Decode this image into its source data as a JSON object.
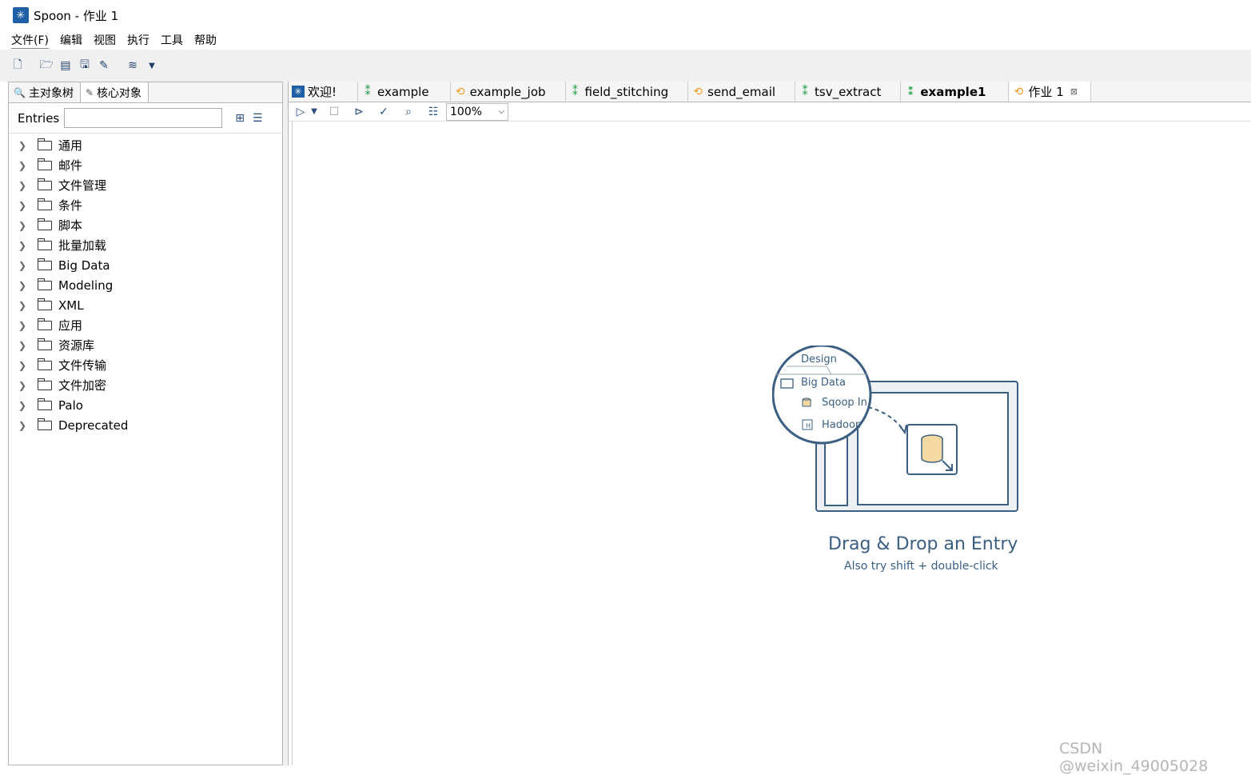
{
  "window": {
    "title": "Spoon - 作业 1"
  },
  "menu": [
    "文件(F)",
    "编辑",
    "视图",
    "执行",
    "工具",
    "帮助"
  ],
  "left": {
    "tabs": [
      "主对象树",
      "核心对象"
    ],
    "search_label": "Entries",
    "search_value": "",
    "tree": [
      "通用",
      "邮件",
      "文件管理",
      "条件",
      "脚本",
      "批量加载",
      "Big Data",
      "Modeling",
      "XML",
      "应用",
      "资源库",
      "文件传输",
      "文件加密",
      "Palo",
      "Deprecated"
    ]
  },
  "tabs": [
    {
      "label": "欢迎!",
      "icon": "welcome-icon"
    },
    {
      "label": "example",
      "icon": "transformation-icon"
    },
    {
      "label": "example_job",
      "icon": "job-icon"
    },
    {
      "label": "field_stitching",
      "icon": "transformation-icon"
    },
    {
      "label": "send_email",
      "icon": "job-icon"
    },
    {
      "label": "tsv_extract",
      "icon": "transformation-icon"
    },
    {
      "label": "example1",
      "icon": "transformation-icon"
    },
    {
      "label": "作业 1",
      "icon": "job-icon"
    }
  ],
  "canvas_toolbar": {
    "zoom": "100%"
  },
  "hint": {
    "design_tab": "Design",
    "folder": "Big Data",
    "item1": "Sqoop In",
    "item2": "Hadoop",
    "title": "Drag & Drop an Entry",
    "subtitle": "Also try shift + double-click"
  },
  "watermark": "CSDN @weixin_49005028",
  "colors": {
    "accent": "#1f5fa6",
    "transformation": "#1a9c3c",
    "job": "#f39a1f",
    "hint": "#3a5f82"
  }
}
